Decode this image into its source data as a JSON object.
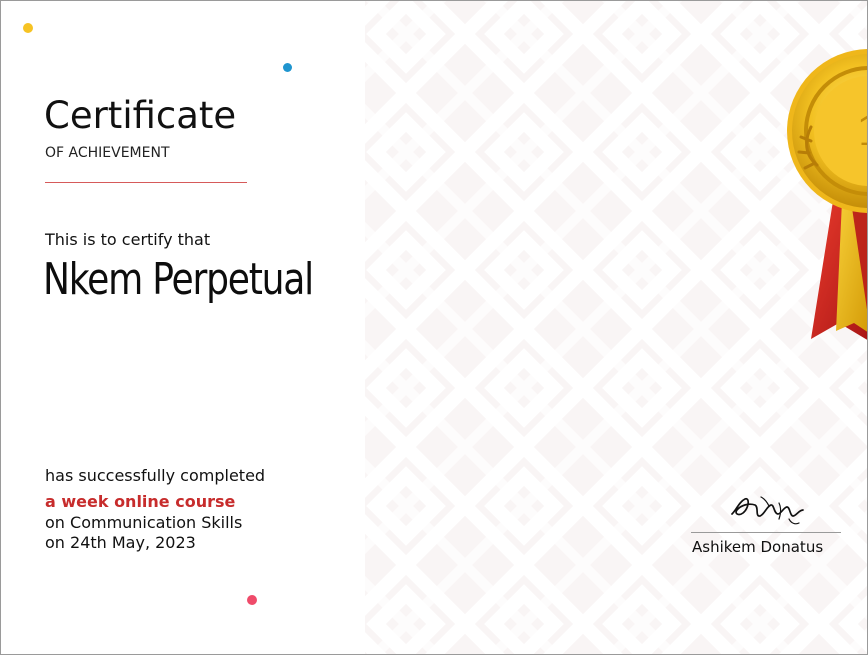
{
  "certificate": {
    "title": "Certificate",
    "subtitle": "OF ACHIEVEMENT",
    "certify_text": "This is to certify that",
    "recipient_name": "Nkem Perpetual",
    "completed_text": "has successfully completed",
    "course_text": "a week online course",
    "topic_text": "on Communication Skills",
    "date_text": "on 24th May, 2023",
    "signer_name": "Ashikem Donatus"
  },
  "icons": {
    "seal": "gold-medal-icon",
    "signature": "handwritten-signature"
  },
  "colors": {
    "accent_red": "#c72c2c",
    "rule_red": "#d65a5a",
    "dot_yellow": "#f6c324",
    "dot_blue": "#1f95cf",
    "dot_pink": "#ef4b6a",
    "pattern_background": "#f9f5f5",
    "pattern_stroke": "#ffffff",
    "medal_gold": "#f2c021",
    "medal_dark_gold": "#c48d08",
    "ribbon_red": "#c8201e"
  }
}
